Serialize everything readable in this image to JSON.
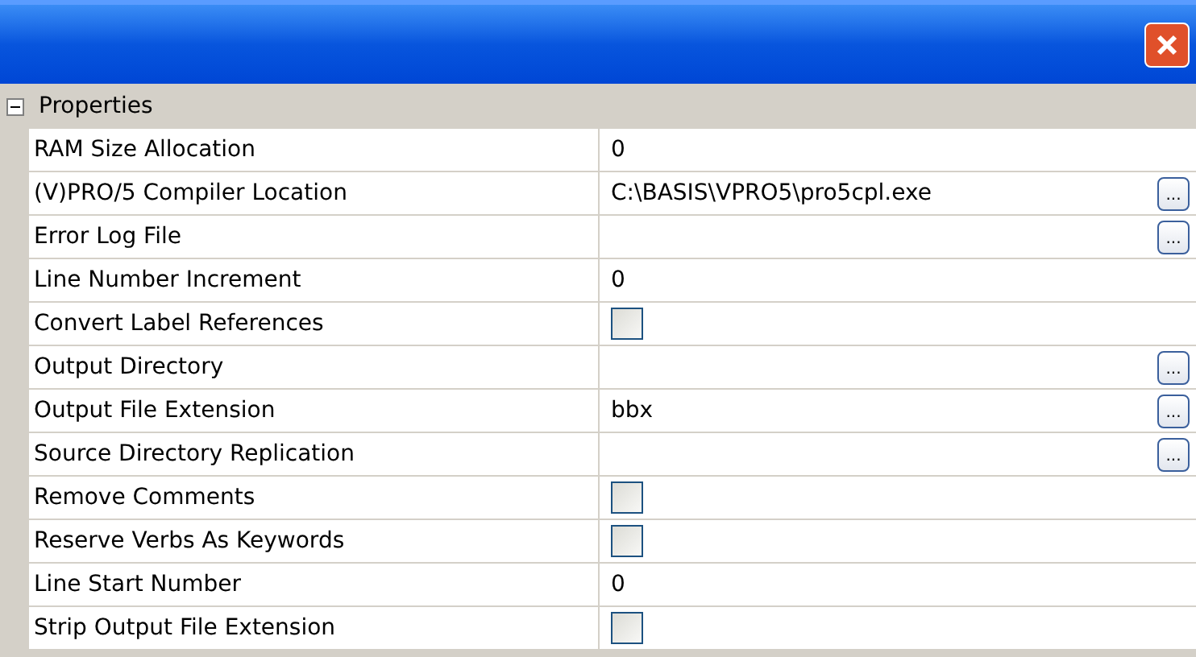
{
  "category": {
    "label": "Properties",
    "expanded": true
  },
  "properties": [
    {
      "name": "RAM Size Allocation",
      "kind": "text",
      "value": "0"
    },
    {
      "name": "(V)PRO/5 Compiler Location",
      "kind": "browse",
      "value": "C:\\BASIS\\VPRO5\\pro5cpl.exe",
      "button": "..."
    },
    {
      "name": "Error Log File",
      "kind": "browse",
      "button": "..."
    },
    {
      "name": "Line Number Increment",
      "kind": "text",
      "value": "0"
    },
    {
      "name": "Convert Label References",
      "kind": "checkbox",
      "checked": false
    },
    {
      "name": "Output Directory",
      "kind": "browse",
      "button": "..."
    },
    {
      "name": "Output File Extension",
      "kind": "browse",
      "value": "bbx",
      "button": "..."
    },
    {
      "name": "Source Directory Replication",
      "kind": "browse",
      "button": "..."
    },
    {
      "name": "Remove Comments",
      "kind": "checkbox",
      "checked": false
    },
    {
      "name": "Reserve Verbs As Keywords",
      "kind": "checkbox",
      "checked": false
    },
    {
      "name": "Line Start Number",
      "kind": "text",
      "value": "0"
    },
    {
      "name": "Strip Output File Extension",
      "kind": "checkbox",
      "checked": false
    }
  ]
}
